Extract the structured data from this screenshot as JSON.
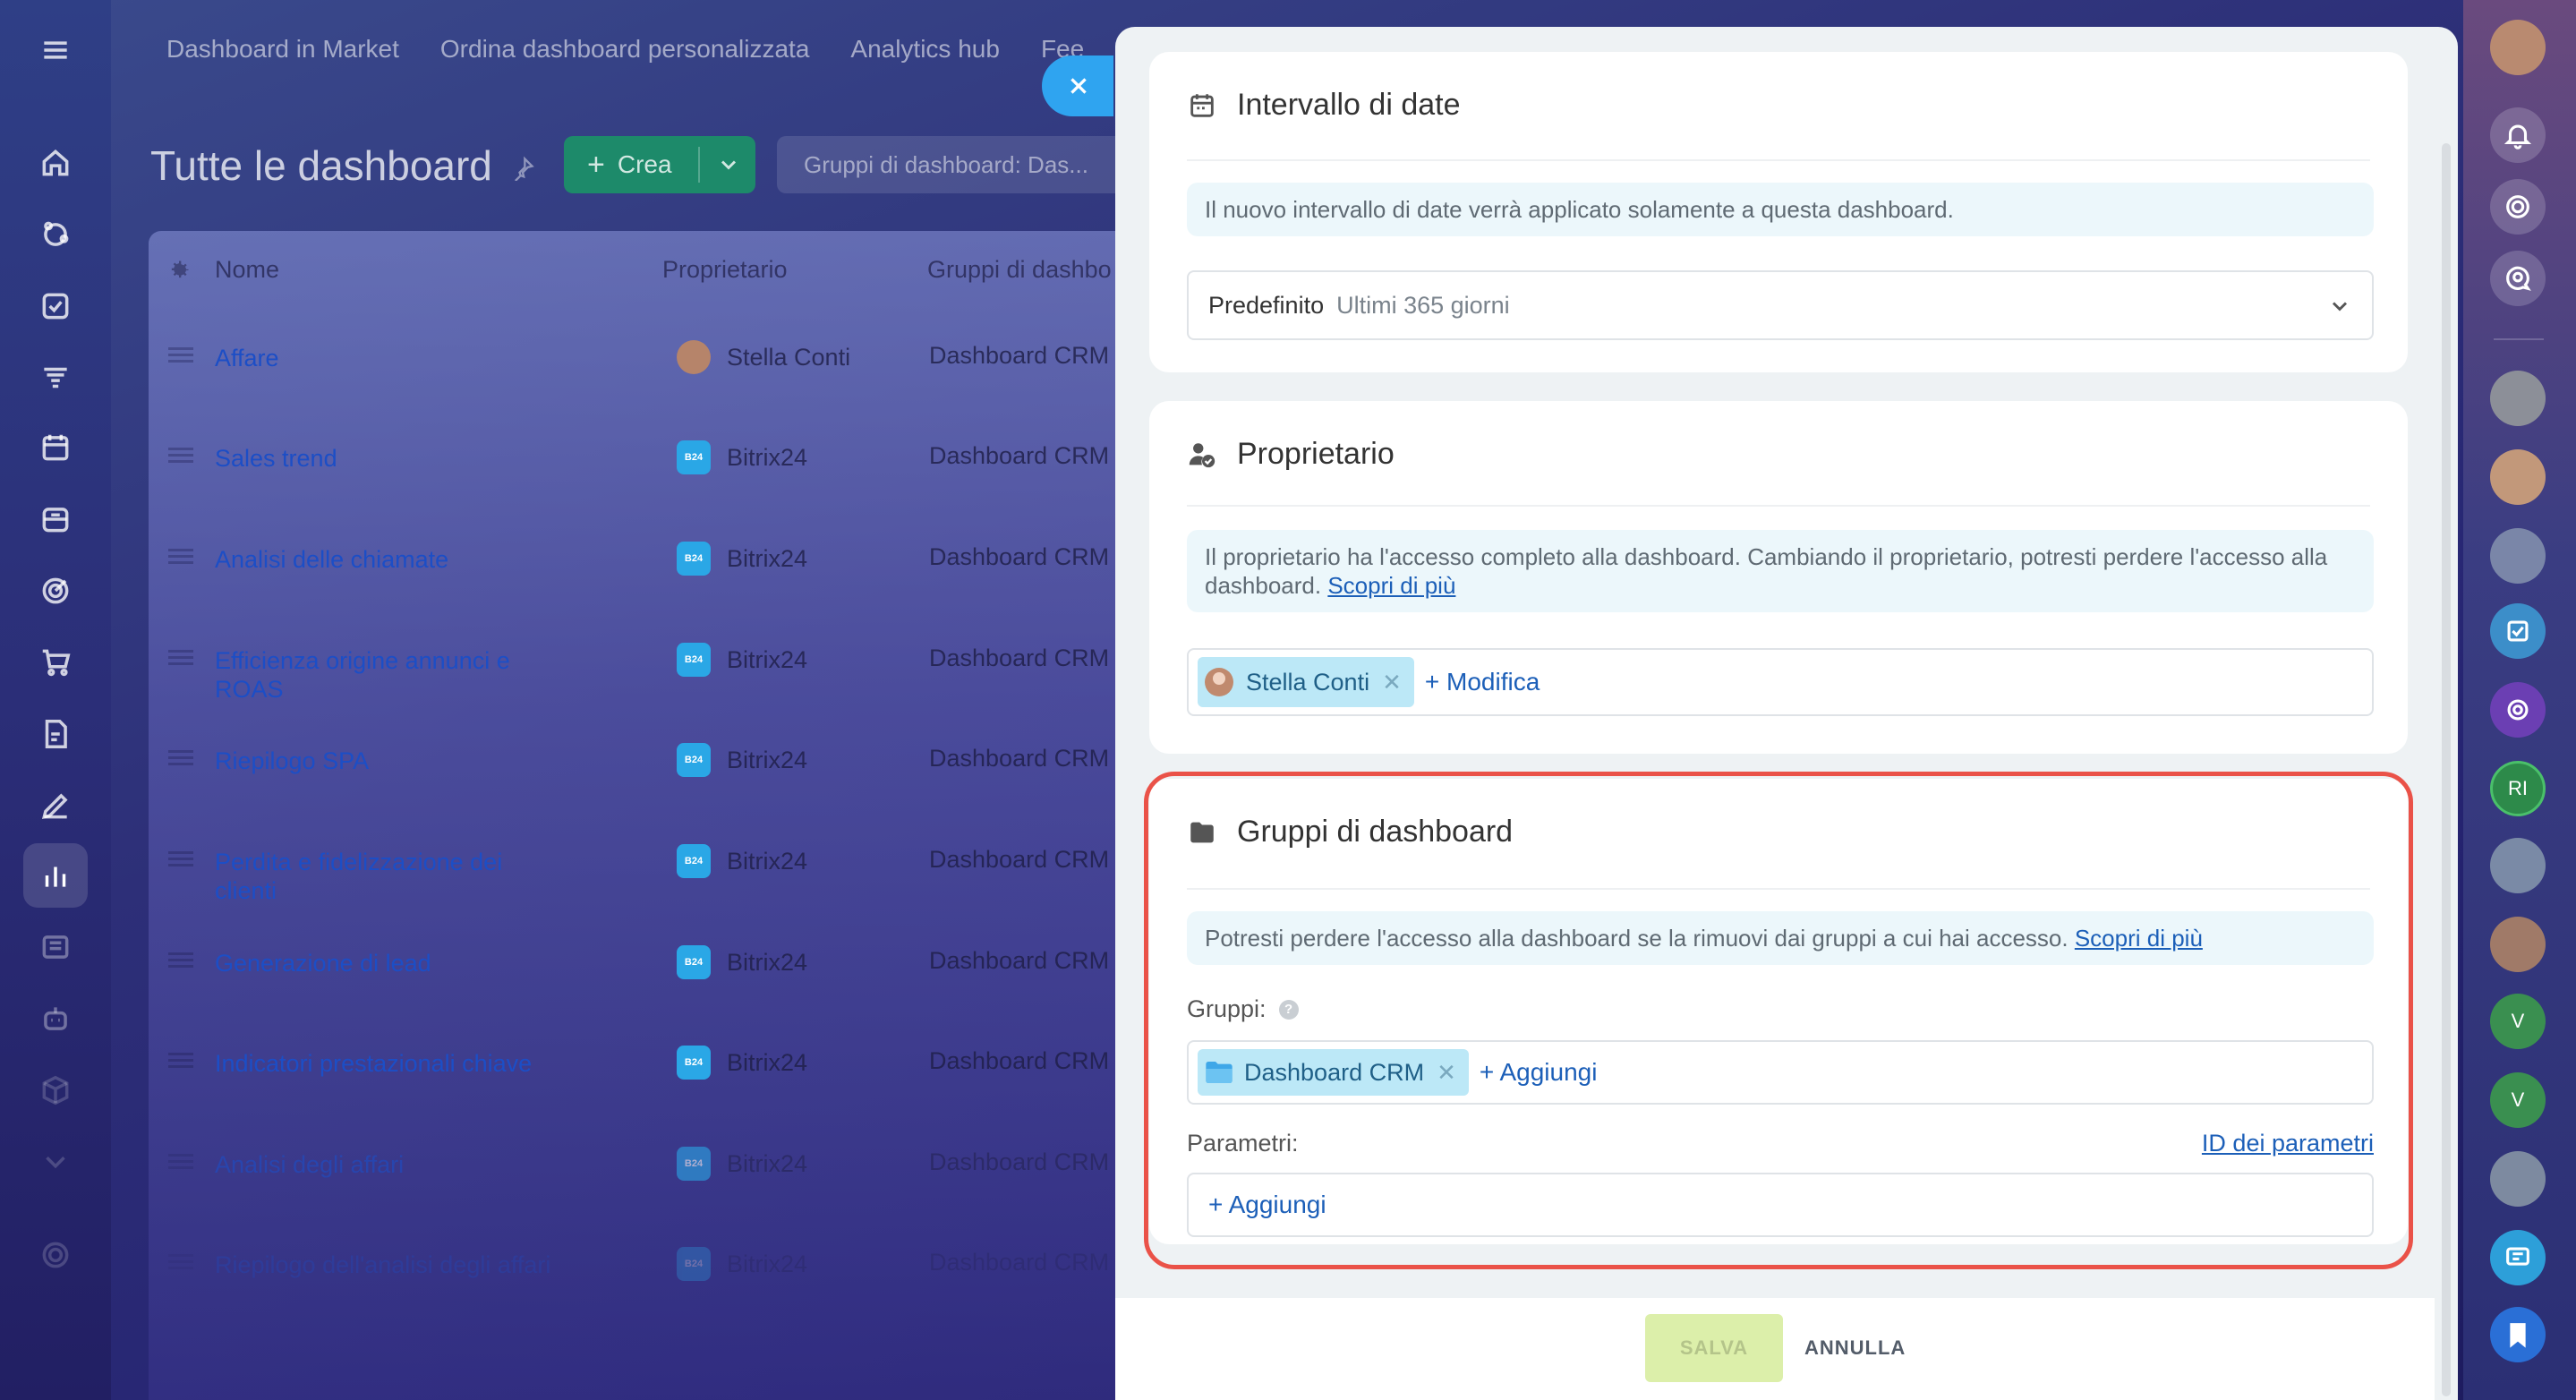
{
  "top_nav": {
    "links": [
      "Dashboard in Market",
      "Ordina dashboard personalizzata",
      "Analytics hub",
      "Fee"
    ]
  },
  "page": {
    "title": "Tutte le dashboard",
    "create_label": "Crea",
    "group_filter": "Gruppi di dashboard: Das..."
  },
  "table": {
    "headers": {
      "name": "Nome",
      "owner": "Proprietario",
      "groups": "Gruppi di dashbo"
    },
    "rows": [
      {
        "name": "Affare",
        "owner": "Stella Conti",
        "group": "Dashboard CRM"
      },
      {
        "name": "Sales trend",
        "owner": "Bitrix24",
        "group": "Dashboard CRM"
      },
      {
        "name": "Analisi delle chiamate",
        "owner": "Bitrix24",
        "group": "Dashboard CRM"
      },
      {
        "name": "Efficienza origine annunci e ROAS",
        "owner": "Bitrix24",
        "group": "Dashboard CRM"
      },
      {
        "name": "Riepilogo SPA",
        "owner": "Bitrix24",
        "group": "Dashboard CRM"
      },
      {
        "name": "Perdita e fidelizzazione dei clienti",
        "owner": "Bitrix24",
        "group": "Dashboard CRM"
      },
      {
        "name": "Generazione di lead",
        "owner": "Bitrix24",
        "group": "Dashboard CRM"
      },
      {
        "name": "Indicatori prestazionali chiave",
        "owner": "Bitrix24",
        "group": "Dashboard CRM"
      },
      {
        "name": "Analisi degli affari",
        "owner": "Bitrix24",
        "group": "Dashboard CRM"
      },
      {
        "name": "Riepilogo dell'analisi degli affari",
        "owner": "Bitrix24",
        "group": "Dashboard CRM"
      }
    ],
    "bitrix_badge": "B24"
  },
  "panel": {
    "date_range": {
      "title": "Intervallo di date",
      "hint": "Il nuovo intervallo di date verrà applicato solamente a questa dashboard.",
      "select_label": "Predefinito",
      "select_value": "Ultimi 365 giorni"
    },
    "owner": {
      "title": "Proprietario",
      "hint": "Il proprietario ha l'accesso completo alla dashboard. Cambiando il proprietario, potresti perdere l'accesso alla dashboard.",
      "hint_link": "Scopri di più",
      "tag": "Stella Conti",
      "modify_label": "+ Modifica"
    },
    "groups": {
      "title": "Gruppi di dashboard",
      "hint": "Potresti perdere l'accesso alla dashboard se la rimuovi dai gruppi a cui hai accesso.",
      "hint_link": "Scopri di più",
      "groups_label": "Gruppi:",
      "help": "?",
      "group_tag": "Dashboard CRM",
      "add_label": "+ Aggiungi",
      "params_label": "Parametri:",
      "params_link": "ID dei parametri",
      "params_add": "+ Aggiungi"
    },
    "footer": {
      "save": "SALVA",
      "cancel": "ANNULLA"
    }
  },
  "right_sidebar": {
    "initials_ri": "RI",
    "initials_v1": "V",
    "initials_v2": "V"
  },
  "colors": {
    "accent": "#1c5fb8",
    "highlight": "#ea5248",
    "create_button": "#1d8a6a",
    "close_button": "#2fa4f0",
    "hint_bg": "#ecf7fb",
    "tag_bg": "#bce8f7"
  }
}
